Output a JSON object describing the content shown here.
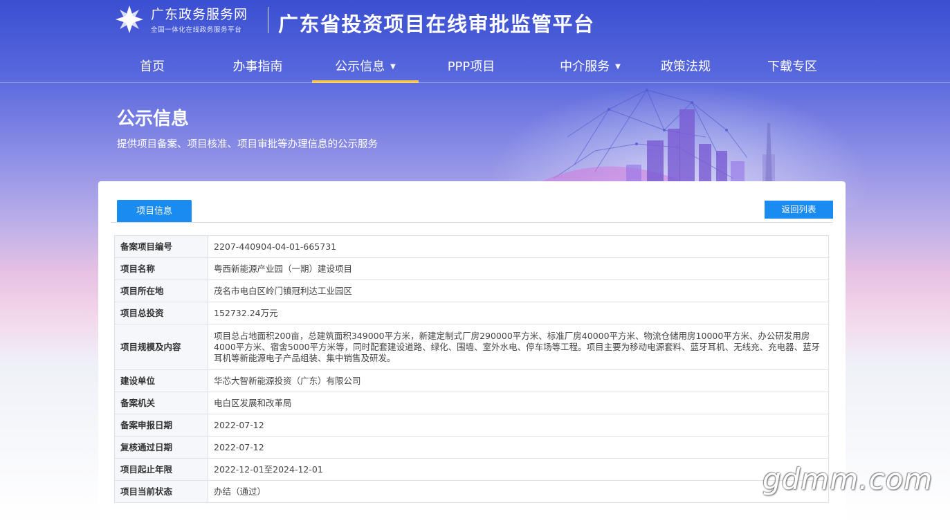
{
  "header": {
    "brand_name": "广东政务服务网",
    "brand_sub": "全国一体化在线政务服务平台",
    "platform_title": "广东省投资项目在线审批监管平台"
  },
  "nav": {
    "items": [
      {
        "label": "首页"
      },
      {
        "label": "办事指南"
      },
      {
        "label": "公示信息",
        "active": true,
        "dropdown": true
      },
      {
        "label": "PPP项目"
      },
      {
        "label": "中介服务",
        "dropdown": true
      },
      {
        "label": "政策法规"
      },
      {
        "label": "下载专区"
      }
    ],
    "caret": "▼",
    "active_color": "#f4c342"
  },
  "hero": {
    "title": "公示信息",
    "subtitle": "提供项目备案、项目核准、项目审批等办理信息的公示服务"
  },
  "panel": {
    "tab_label": "项目信息",
    "back_label": "返回列表",
    "accent": "#1a8bf0"
  },
  "table": {
    "rows": [
      {
        "label": "备案项目编号",
        "value": "2207-440904-04-01-665731"
      },
      {
        "label": "项目名称",
        "value": "粤西新能源产业园（一期）建设项目"
      },
      {
        "label": "项目所在地",
        "value": "茂名市电白区岭门镇冠利达工业园区"
      },
      {
        "label": "项目总投资",
        "value": "152732.24万元"
      },
      {
        "label": "项目规模及内容",
        "value": "项目总占地面积200亩，总建筑面积349000平方米，新建定制式厂房290000平方米、标准厂房40000平方米、物流仓储用房10000平方米、办公研发用房4000平方米、宿舍5000平方米等，同时配套建设道路、绿化、围墙、室外水电、停车场等工程。项目主要为移动电源套料、蓝牙耳机、无线充、充电器、蓝牙耳机等新能源电子产品组装、集中销售及研发。"
      },
      {
        "label": "建设单位",
        "value": "华芯大智新能源投资（广东）有限公司"
      },
      {
        "label": "备案机关",
        "value": "电白区发展和改革局"
      },
      {
        "label": "备案申报日期",
        "value": "2022-07-12"
      },
      {
        "label": "复核通过日期",
        "value": "2022-07-12"
      },
      {
        "label": "项目起止年限",
        "value": "2022-12-01至2024-12-01"
      },
      {
        "label": "项目当前状态",
        "value": "办结（通过）"
      }
    ]
  },
  "watermark": "gdmm.com"
}
